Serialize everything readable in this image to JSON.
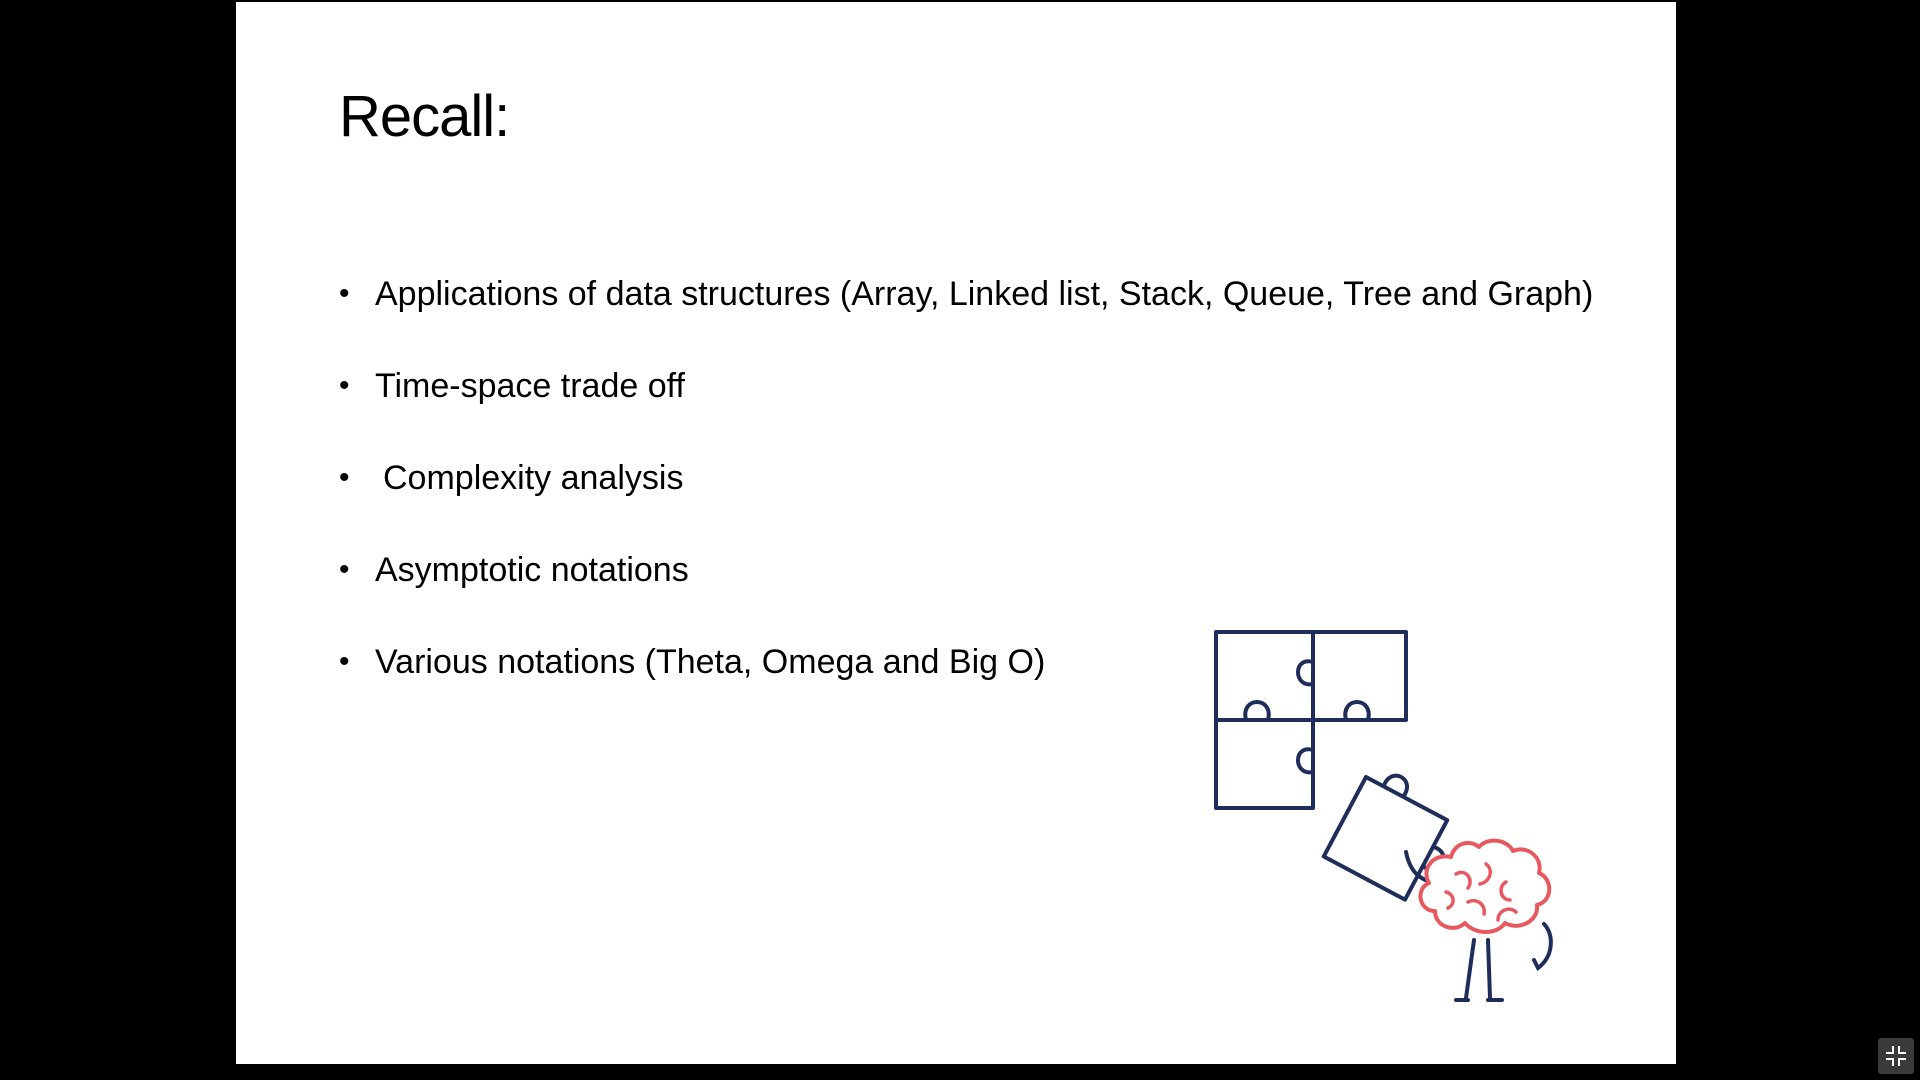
{
  "slide": {
    "title": "Recall:",
    "bullets": [
      {
        "text": "Applications of data structures (Array, Linked list, Stack, Queue, Tree and Graph)"
      },
      {
        "text": "Time-space trade off"
      },
      {
        "text": "Complexity analysis"
      },
      {
        "text": "Asymptotic notations"
      },
      {
        "text": "Various notations (Theta, Omega and Big O)"
      }
    ],
    "bullet_glyph": "•"
  },
  "illustration": {
    "icons": [
      "puzzle-icon",
      "brain-character-icon"
    ],
    "colors": {
      "puzzle": "#1f2d5a",
      "brain": "#e8595f",
      "legs": "#1f2d5a"
    }
  },
  "controls": {
    "exit_fullscreen_icon": "exit-fullscreen-icon"
  },
  "colors": {
    "viewer_background": "#000000",
    "slide_background": "#ffffff",
    "text": "#000000"
  }
}
